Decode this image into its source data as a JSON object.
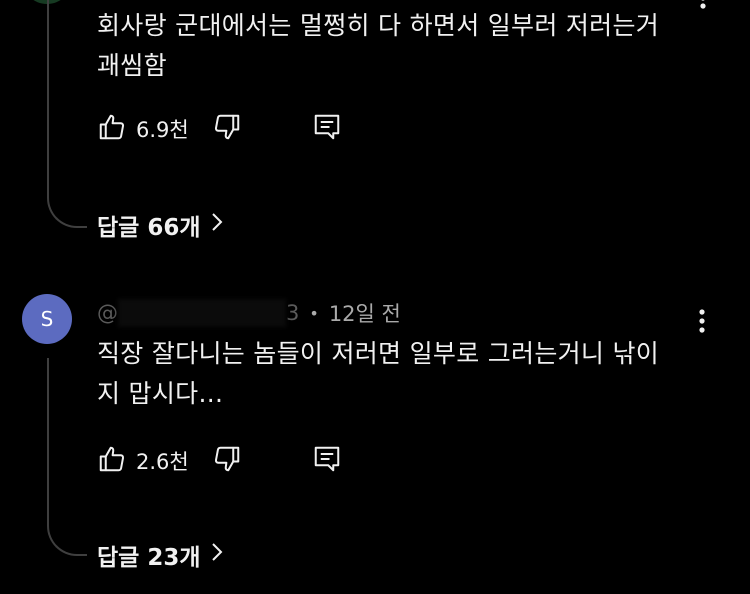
{
  "comment1": {
    "text_line1": "회사랑 군대에서는 멀쩡히 다 하면서 일부러 저러는거",
    "text_line2": "괘씸함",
    "like_count": "6.9천",
    "replies_label": "답글 66개"
  },
  "comment2": {
    "avatar_letter": "S",
    "handle_prefix": "@",
    "handle_suffix": "3",
    "separator": "•",
    "time_ago": "12일 전",
    "text_line1": "직장 잘다니는 놈들이 저러면 일부로 그러는거니 낚이",
    "text_line2": "지 맙시다...",
    "like_count": "2.6천",
    "replies_label": "답글 23개"
  },
  "icons": {
    "like": "thumbs-up-icon",
    "dislike": "thumbs-down-icon",
    "reply": "comment-icon",
    "more": "more-vertical-icon",
    "chevron": "chevron-right-icon"
  },
  "colors": {
    "background": "#000000",
    "text": "#f1f1f1",
    "meta": "#aaaaaa",
    "avatar": "#5c6bc0",
    "thread_line": "#3f3f3f"
  }
}
